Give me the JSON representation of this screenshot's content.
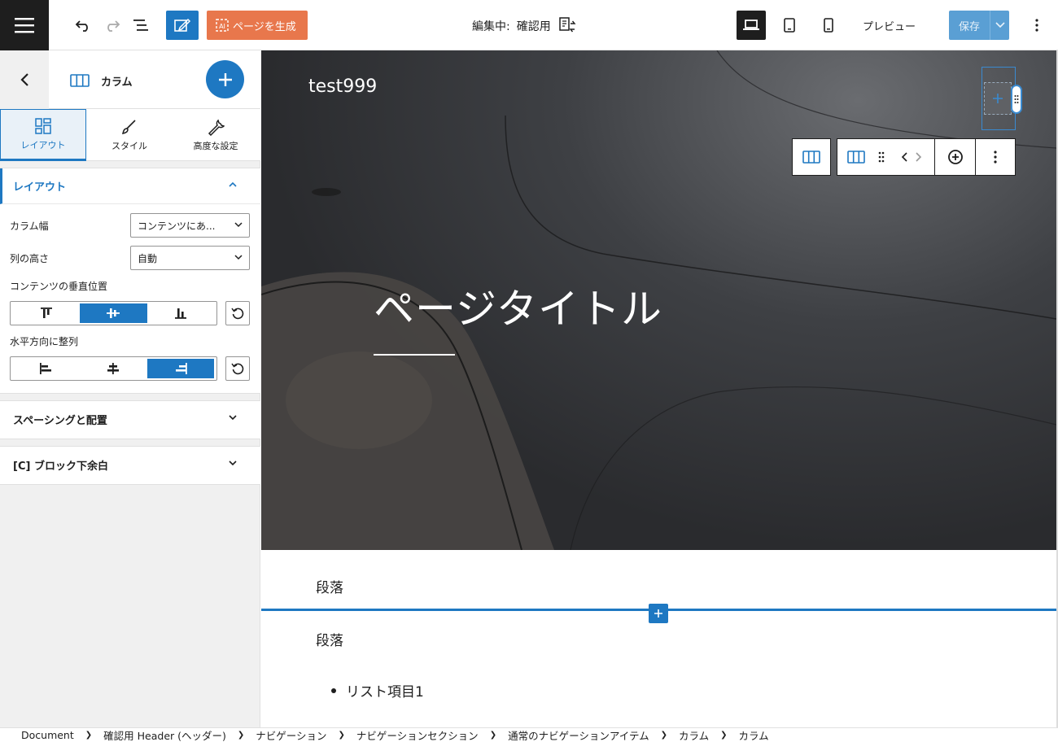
{
  "topbar": {
    "generate_label": "ページを生成",
    "editing_prefix": "編集中:",
    "editing_name": "確認用",
    "preview_label": "プレビュー",
    "save_label": "保存"
  },
  "sidebar": {
    "block_title": "カラム",
    "tabs": [
      {
        "label": "レイアウト",
        "active": true
      },
      {
        "label": "スタイル",
        "active": false
      },
      {
        "label": "高度な設定",
        "active": false
      }
    ],
    "layout_panel": {
      "title": "レイアウト",
      "column_width_label": "カラム幅",
      "column_width_value": "コンテンツにあ...",
      "row_height_label": "列の高さ",
      "row_height_value": "自動",
      "vertical_align_label": "コンテンツの垂直位置",
      "vertical_align_selected": "center",
      "horizontal_align_label": "水平方向に整列",
      "horizontal_align_selected": "right"
    },
    "spacing_panel_title": "スペーシングと配置",
    "margin_panel_title": "[C] ブロック下余白"
  },
  "canvas": {
    "site_title": "test999",
    "page_title": "ページタイトル",
    "paragraph_1": "段落",
    "paragraph_2": "段落",
    "list_item_1": "リスト項目1"
  },
  "breadcrumb": [
    "Document",
    "確認用 Header (ヘッダー)",
    "ナビゲーション",
    "ナビゲーションセクション",
    "通常のナビゲーションアイテム",
    "カラム",
    "カラム"
  ],
  "colors": {
    "accent": "#1e78c2",
    "generate_button": "#e8774c",
    "dark": "#1e1e1e"
  }
}
